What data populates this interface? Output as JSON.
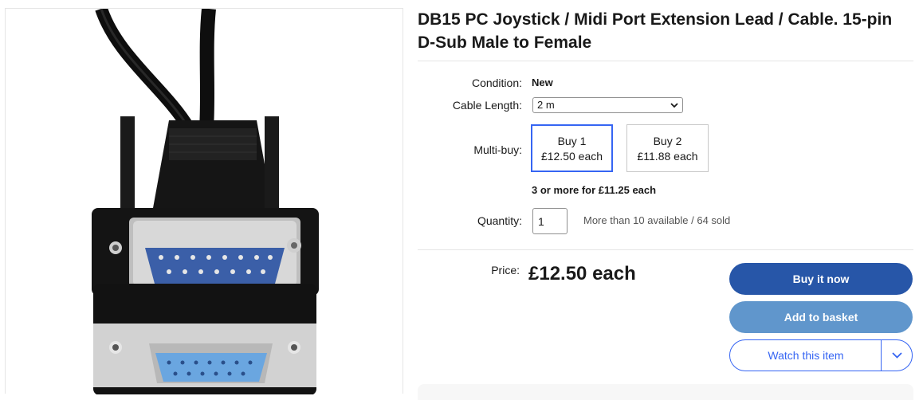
{
  "listing": {
    "title": "DB15 PC Joystick / Midi Port Extension Lead / Cable. 15-pin D-Sub Male to Female"
  },
  "condition": {
    "label": "Condition:",
    "value": "New"
  },
  "cable_length": {
    "label": "Cable Length:",
    "selected": "2 m"
  },
  "multibuy": {
    "label": "Multi-buy:",
    "tiers": [
      {
        "line1": "Buy 1",
        "line2": "£12.50 each",
        "selected": true
      },
      {
        "line1": "Buy 2",
        "line2": "£11.88 each",
        "selected": false
      }
    ],
    "note": "3 or more for £11.25 each"
  },
  "quantity": {
    "label": "Quantity:",
    "value": "1",
    "availability": "More than 10 available / 64 sold"
  },
  "price": {
    "label": "Price:",
    "value": "£12.50 each"
  },
  "actions": {
    "buy_now": "Buy it now",
    "add_to_basket": "Add to basket",
    "watch": "Watch this item"
  },
  "colors": {
    "buy_now_bg": "#2756a8",
    "basket_bg": "#6096cc",
    "link_blue": "#3665f3",
    "cable_black": "#111111",
    "connector_blue": "#3b5fa8",
    "connector_lightblue": "#6aa6e0"
  },
  "icons": {
    "select_chevron": "chevron-down-icon",
    "watch_dropdown": "chevron-down-icon"
  }
}
